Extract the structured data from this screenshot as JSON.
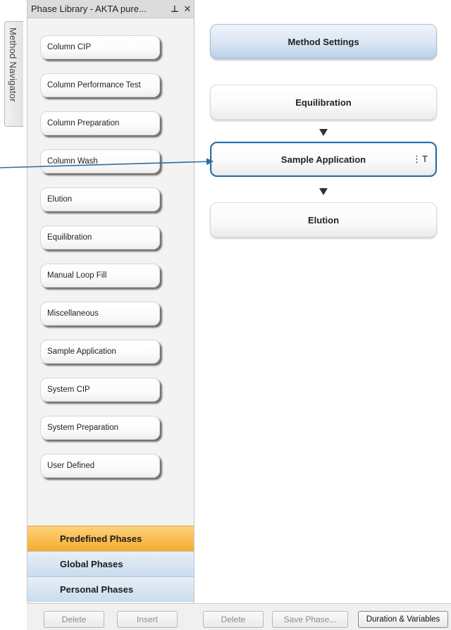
{
  "navigator": {
    "tab_label": "Method Navigator"
  },
  "library": {
    "title": "Phase Library - AKTA pure...",
    "pin_icon": "pin-icon",
    "close_icon": "close-icon",
    "items": [
      "Column CIP",
      "Column Performance Test",
      "Column Preparation",
      "Column Wash",
      "Elution",
      "Equilibration",
      "Manual Loop Fill",
      "Miscellaneous",
      "Sample Application",
      "System CIP",
      "System Preparation",
      "User Defined"
    ],
    "categories": {
      "predefined": "Predefined Phases",
      "global": "Global Phases",
      "personal": "Personal Phases"
    },
    "buttons": {
      "delete": "Delete",
      "insert": "Insert"
    }
  },
  "method": {
    "phases": {
      "settings": "Method Settings",
      "equilibration": "Equilibration",
      "sample_application": "Sample Application",
      "elution": "Elution"
    },
    "sample_handle": "⋮T",
    "buttons": {
      "delete": "Delete",
      "save_phase": "Save Phase...",
      "duration_variables": "Duration & Variables"
    }
  },
  "colors": {
    "accent_selected": "#2b6ea6",
    "predefined_active": "#f5ab2e",
    "category_inactive": "#c9dcee"
  }
}
